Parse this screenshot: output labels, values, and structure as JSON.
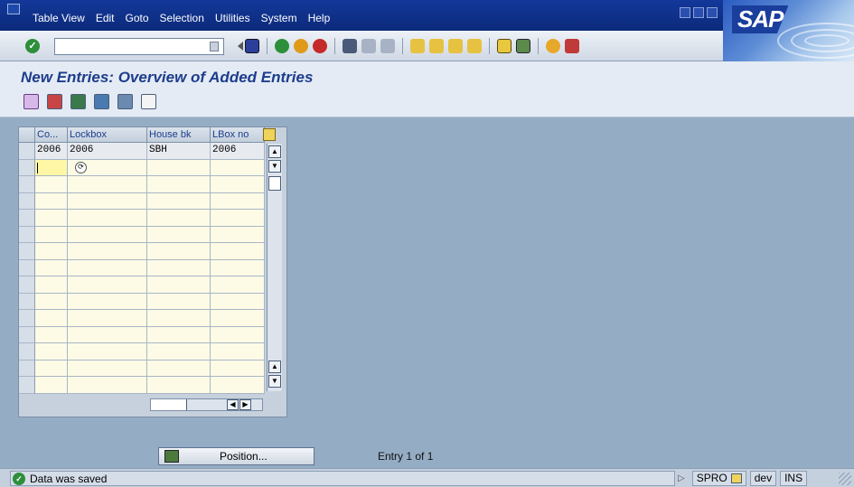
{
  "menubar": {
    "items": [
      "Table View",
      "Edit",
      "Goto",
      "Selection",
      "Utilities",
      "System",
      "Help"
    ]
  },
  "logo": {
    "text": "SAP"
  },
  "command_field": {
    "value": ""
  },
  "title": "New Entries: Overview of Added Entries",
  "table": {
    "columns": [
      "Co...",
      "Lockbox",
      "House bk",
      "LBox no"
    ],
    "rows": [
      [
        "2006",
        "2006",
        "SBH",
        "2006"
      ]
    ]
  },
  "position_button": {
    "label": "Position..."
  },
  "entry_info": "Entry 1 of 1",
  "status": {
    "message": "Data was saved",
    "transaction": "SPRO",
    "system": "dev",
    "mode": "INS"
  },
  "colors": {
    "menubar": "#12389a",
    "background": "#95adc4",
    "title": "#1d3d8c",
    "ok_green": "#2d8f3a"
  },
  "icons": {
    "toolbar": [
      "enter-check-icon",
      "command-history-icon",
      "back-icon",
      "save-icon",
      "back-green-icon",
      "exit-icon",
      "cancel-icon",
      "print-icon",
      "find-icon",
      "find-next-icon",
      "first-page-icon",
      "prev-page-icon",
      "next-page-icon",
      "last-page-icon",
      "create-session-icon",
      "shortcut-icon",
      "help-icon",
      "layout-icon"
    ],
    "app": [
      "change-icon",
      "save-entries-icon",
      "select-all-icon",
      "select-block-icon",
      "deselect-icon",
      "details-icon"
    ]
  }
}
